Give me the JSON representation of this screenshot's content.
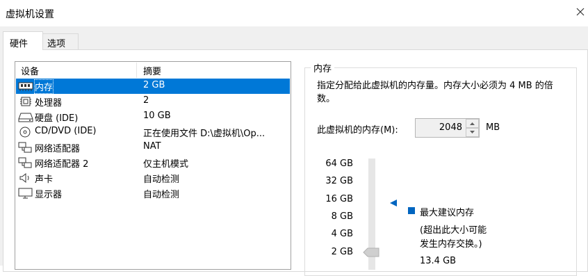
{
  "window": {
    "title": "虚拟机设置"
  },
  "tabs": [
    {
      "label": "硬件"
    },
    {
      "label": "选项"
    }
  ],
  "device_list": {
    "headers": {
      "device": "设备",
      "summary": "摘要"
    },
    "rows": [
      {
        "icon": "memory-icon",
        "name": "内存",
        "summary": "2 GB",
        "selected": true
      },
      {
        "icon": "processor-icon",
        "name": "处理器",
        "summary": "2"
      },
      {
        "icon": "hard-disk-icon",
        "name": "硬盘 (IDE)",
        "summary": "10 GB"
      },
      {
        "icon": "cd-dvd-icon",
        "name": "CD/DVD (IDE)",
        "summary": "正在使用文件 D:\\虚拟机\\Op..."
      },
      {
        "icon": "network-adapter-icon",
        "name": "网络适配器",
        "summary": "NAT"
      },
      {
        "icon": "network-adapter-icon",
        "name": "网络适配器 2",
        "summary": "仅主机模式"
      },
      {
        "icon": "sound-card-icon",
        "name": "声卡",
        "summary": "自动检测"
      },
      {
        "icon": "display-icon",
        "name": "显示器",
        "summary": "自动检测"
      }
    ]
  },
  "memory": {
    "group_title": "内存",
    "description": "指定分配给此虚拟机的内存量。内存大小必须为 4 MB 的倍数。",
    "field_label": "此虚拟机的内存(M):",
    "value": "2048",
    "unit": "MB",
    "scale_ticks": [
      "64 GB",
      "32 GB",
      "16 GB",
      "8 GB",
      "4 GB",
      "2 GB"
    ],
    "slider_value_gb": 2,
    "recommended": {
      "label": "最大建议内存",
      "note_line1": "(超出此大小可能",
      "note_line2": "发生内存交换。)",
      "value": "13.4 GB"
    }
  },
  "colors": {
    "selection": "#0078d7",
    "accent": "#0065c0"
  }
}
